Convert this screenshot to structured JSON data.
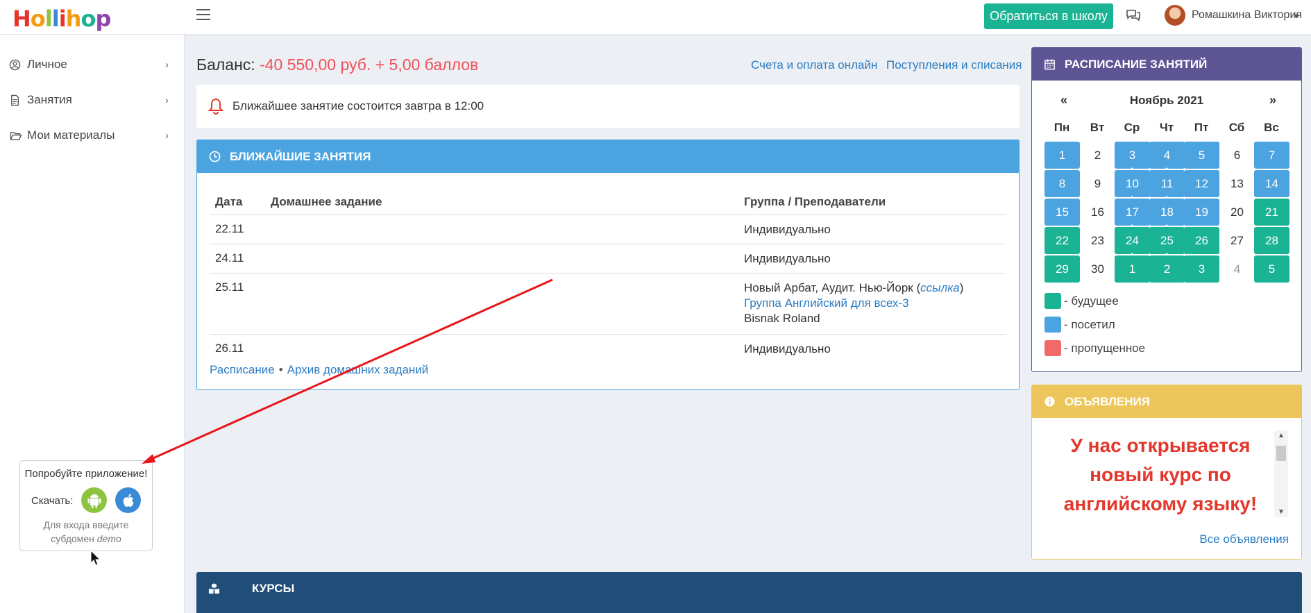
{
  "header": {
    "logo_letters": [
      "H",
      "o",
      "l",
      "l",
      "i",
      "h",
      "o",
      "p"
    ],
    "logo_colors": [
      "#e8352b",
      "#f39c12",
      "#8cc43f",
      "#3b8ad8",
      "#e8352b",
      "#f39c12",
      "#1ab394",
      "#8e44ad"
    ],
    "contact_school_label": "Обратиться в школу",
    "user_name": "Ромашкина Виктория"
  },
  "sidebar": {
    "items": [
      {
        "label": "Личное",
        "icon": "user-circle-icon"
      },
      {
        "label": "Занятия",
        "icon": "document-icon"
      },
      {
        "label": "Мои материалы",
        "icon": "folder-open-icon"
      }
    ]
  },
  "promo": {
    "title": "Попробуйте приложение!",
    "download_label": "Скачать:",
    "note_line1": "Для входа введите",
    "note_line2_prefix": "субдомен",
    "note_line2_em": "demo"
  },
  "balance": {
    "label": "Баланс:",
    "value": "-40 550,00 руб. + 5,00 баллов",
    "link_invoices": "Счета и оплата онлайн",
    "link_transactions": "Поступления и списания"
  },
  "notice": {
    "text": "Ближайшее занятие состоится завтра в 12:00"
  },
  "upcoming": {
    "title": "БЛИЖАЙШИЕ ЗАНЯТИЯ",
    "columns": [
      "Дата",
      "Домашнее задание",
      "Группа / Преподаватели"
    ],
    "rows": [
      {
        "date": "22.11",
        "group": "Индивидуально"
      },
      {
        "date": "24.11",
        "group": "Индивидуально"
      },
      {
        "date": "25.11",
        "location": "Новый Арбат, Аудит. Нью-Йорк (",
        "location_link": "ссылка",
        "location_close": ")",
        "group": "Группа Английский для всех-3",
        "teacher": "Bisnak Roland"
      },
      {
        "date": "26.11",
        "group": "Индивидуально"
      }
    ],
    "footer_schedule": "Расписание",
    "footer_sep": "•",
    "footer_archive": "Архив домашних заданий"
  },
  "schedule": {
    "title": "РАСПИСАНИЕ ЗАНЯТИЙ",
    "prev": "«",
    "next": "»",
    "month": "Ноябрь 2021",
    "weekdays": [
      "Пн",
      "Вт",
      "Ср",
      "Чт",
      "Пт",
      "Сб",
      "Вс"
    ],
    "weeks": [
      [
        {
          "d": "1",
          "s": "visited"
        },
        {
          "d": "2",
          "s": ""
        },
        {
          "d": "3",
          "s": "visited",
          "m": true
        },
        {
          "d": "4",
          "s": "visited",
          "m": true
        },
        {
          "d": "5",
          "s": "visited"
        },
        {
          "d": "6",
          "s": ""
        },
        {
          "d": "7",
          "s": "visited"
        }
      ],
      [
        {
          "d": "8",
          "s": "visited"
        },
        {
          "d": "9",
          "s": ""
        },
        {
          "d": "10",
          "s": "visited",
          "m": true
        },
        {
          "d": "11",
          "s": "visited",
          "m": true
        },
        {
          "d": "12",
          "s": "visited"
        },
        {
          "d": "13",
          "s": ""
        },
        {
          "d": "14",
          "s": "visited"
        }
      ],
      [
        {
          "d": "15",
          "s": "visited"
        },
        {
          "d": "16",
          "s": ""
        },
        {
          "d": "17",
          "s": "visited",
          "m": true
        },
        {
          "d": "18",
          "s": "visited",
          "m": true
        },
        {
          "d": "19",
          "s": "visited"
        },
        {
          "d": "20",
          "s": ""
        },
        {
          "d": "21",
          "s": "future"
        }
      ],
      [
        {
          "d": "22",
          "s": "future"
        },
        {
          "d": "23",
          "s": ""
        },
        {
          "d": "24",
          "s": "future",
          "m": true
        },
        {
          "d": "25",
          "s": "future",
          "m": true
        },
        {
          "d": "26",
          "s": "future"
        },
        {
          "d": "27",
          "s": ""
        },
        {
          "d": "28",
          "s": "future"
        }
      ],
      [
        {
          "d": "29",
          "s": "future"
        },
        {
          "d": "30",
          "s": ""
        },
        {
          "d": "1",
          "s": "future"
        },
        {
          "d": "2",
          "s": "future"
        },
        {
          "d": "3",
          "s": "future"
        },
        {
          "d": "4",
          "s": "muted"
        },
        {
          "d": "5",
          "s": "future"
        }
      ]
    ],
    "legend": [
      {
        "label": "- будущее",
        "color": "#1ab394"
      },
      {
        "label": "- посетил",
        "color": "#4ba3e0"
      },
      {
        "label": "- пропущенное",
        "color": "#f06a6a"
      }
    ]
  },
  "announcements": {
    "title": "ОБЪЯВЛЕНИЯ",
    "text": "У нас открывается новый курс по английскому языку!",
    "all_link": "Все объявления"
  },
  "courses": {
    "title": "КУРСЫ"
  }
}
